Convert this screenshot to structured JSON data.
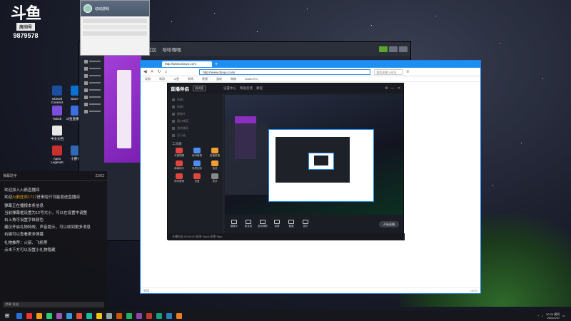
{
  "logo": {
    "mark": "斗鱼",
    "sub": "房间号",
    "room": "9879578"
  },
  "desktop_icons": [
    {
      "label": "Ubisoft Connect",
      "color": "#1a4fa0"
    },
    {
      "label": "DouYu",
      "color": "#0c6fd1"
    },
    {
      "label": "Twitch",
      "color": "#7b4fd9"
    },
    {
      "label": "斗鱼直播伴侣",
      "color": "#3c6ee0"
    },
    {
      "label": "中文文档",
      "color": "#e8e8e8"
    },
    {
      "label": "Apex Legends",
      "color": "#c9302c"
    },
    {
      "label": "小部件",
      "color": "#3069b5"
    },
    {
      "label": "Steam",
      "color": "#c7a56a"
    }
  ],
  "chat_window": {
    "name": "动动游戏"
  },
  "mid_window": {
    "tabs": [
      "商店",
      "库",
      "社区",
      "哈哈嘎嘎"
    ]
  },
  "left_chat": {
    "title": "弹幕助手",
    "count": "22/62",
    "messages": [
      {
        "pre": "欢迎加入火箭直播间",
        "hl": "",
        "post": ""
      },
      {
        "pre": "欢迎",
        "hl": "火箭狂欢1717",
        "post": "进来啦只可能混进直播间"
      },
      {
        "pre": "",
        "hl": "",
        "post": ""
      },
      {
        "pre": "弹幕正在播报本条信息",
        "hl": "",
        "post": ""
      },
      {
        "pre": "当前弹幕框设置为12号大小，可以在设置中调整",
        "hl": "",
        "post": ""
      },
      {
        "pre": "右上角可设置字体颜色",
        "hl": "",
        "post": ""
      },
      {
        "pre": "建议开启礼物特效，声音提示，可以收到更多消息",
        "hl": "",
        "post": ""
      },
      {
        "pre": "右键可以查看更多弹幕",
        "hl": "",
        "post": ""
      },
      {
        "pre": "",
        "hl": "",
        "post": ""
      },
      {
        "pre": "礼物推荐：火箭、飞机等",
        "hl": "",
        "post": ""
      },
      {
        "pre": "点击下方可以设置小礼物隐藏",
        "hl": "",
        "post": ""
      }
    ],
    "input": "弹幕 发送"
  },
  "browser": {
    "tab": "http://www.douyu.com",
    "address": "http://www.douyu.com/",
    "search": "搜索或输入网址",
    "bookmarks": [
      "导航",
      "常用",
      "斗鱼",
      "新闻",
      "视频",
      "游戏",
      "购物",
      "Wallet Ext"
    ],
    "status_left": "就绪",
    "status_right": "100%"
  },
  "app": {
    "logo": "直播伴侣",
    "version": "测试版",
    "tabs": [
      "设置中心",
      "帮助反馈",
      "教程"
    ],
    "scenes": [
      "场景1",
      "场景2",
      "摄像头",
      "窗口捕获",
      "游戏捕获",
      "显示器"
    ],
    "tools_title": "工具箱",
    "tools": [
      {
        "label": "开播提醒",
        "color": "#e0463d"
      },
      {
        "label": "房间管理",
        "color": "#4d8ef0"
      },
      {
        "label": "直播数据",
        "color": "#f0a030"
      },
      {
        "label": "弹幕助手",
        "color": "#e0463d"
      },
      {
        "label": "录屏回放",
        "color": "#4d8ef0"
      },
      {
        "label": "抽奖",
        "color": "#f0a030"
      },
      {
        "label": "房间管理",
        "color": "#e0463d"
      },
      {
        "label": "设置",
        "color": "#e0463d"
      },
      {
        "label": "更多",
        "color": "#8a8a8a"
      }
    ],
    "bottom_buttons": [
      "摄像头",
      "麦克风",
      "游戏捕获",
      "录屏",
      "截图",
      "音乐"
    ],
    "start_live": "开始直播",
    "footer": "开播时长 00:00:00   码率 0kb/s   帧率 0fps"
  },
  "taskbar": {
    "start_icon": "windows-icon",
    "apps": [
      "#2a6fd6",
      "#e33",
      "#f39c12",
      "#2ecc71",
      "#9b59b6",
      "#3498db",
      "#e74c3c",
      "#1abc9c",
      "#f1c40f",
      "#95a5a6",
      "#d35400",
      "#27ae60",
      "#8e44ad",
      "#c0392b",
      "#16a085",
      "#2980b9",
      "#e67e22"
    ],
    "time": "20:29 周四",
    "date": "2021/1/07"
  }
}
